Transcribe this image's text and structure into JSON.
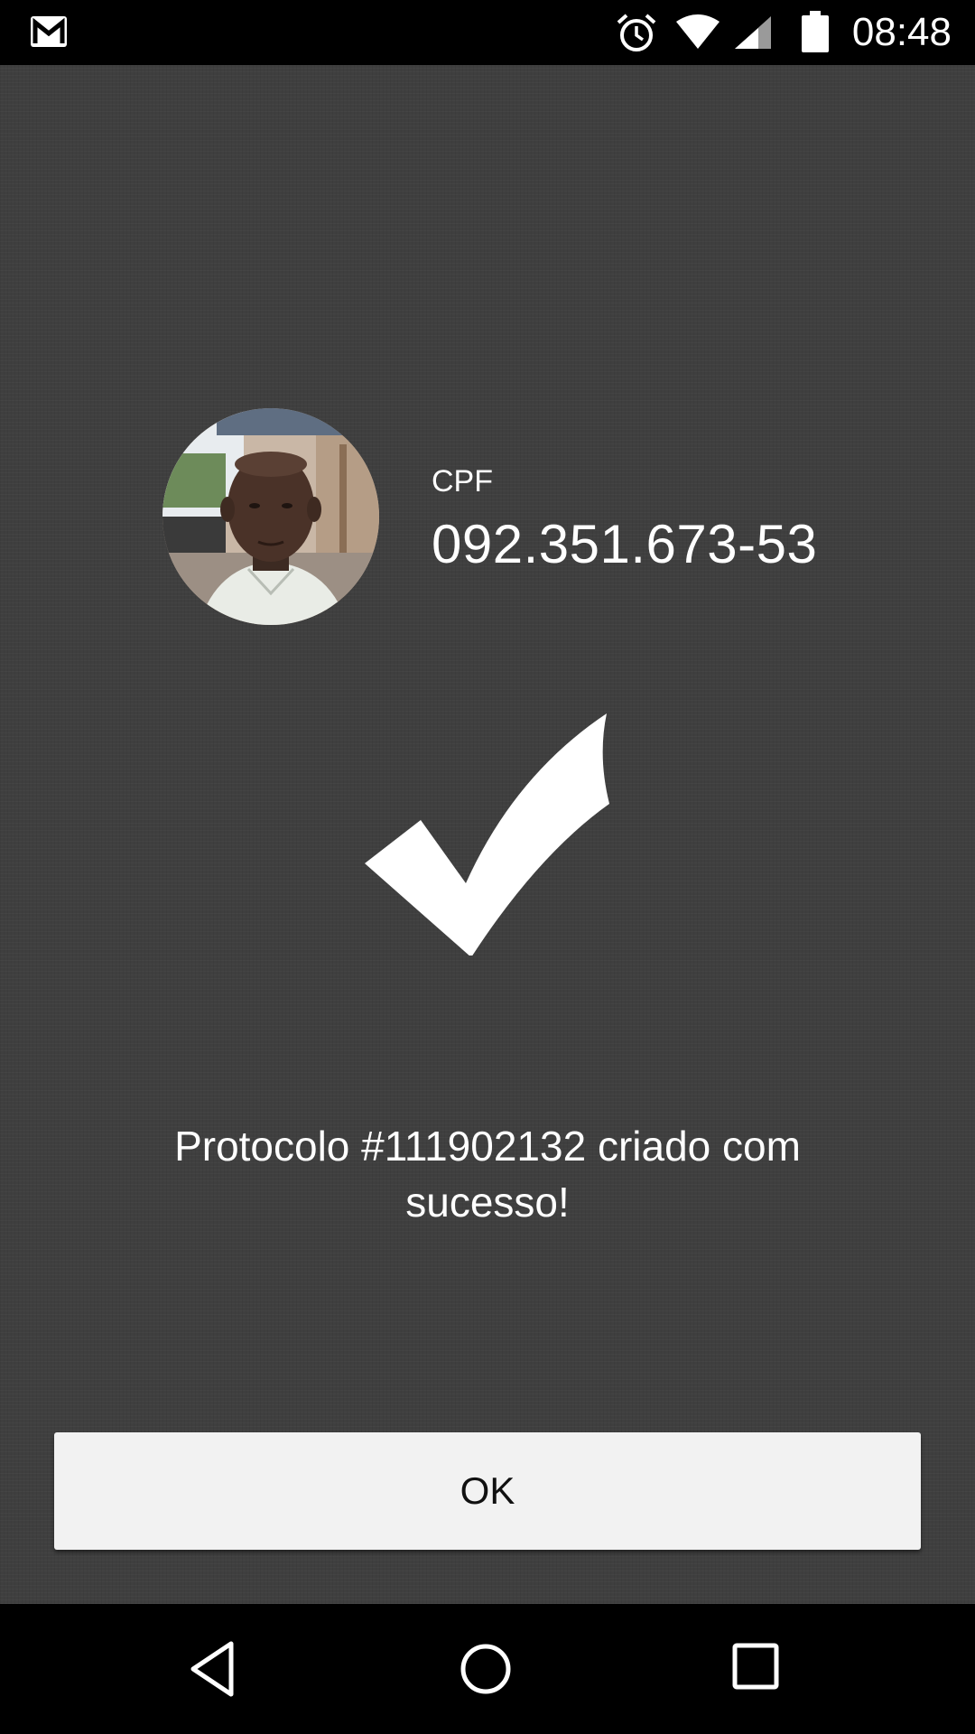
{
  "status_bar": {
    "time": "08:48",
    "icons": [
      "gmail-icon",
      "alarm-icon",
      "wifi-icon",
      "cell-signal-icon",
      "battery-icon"
    ]
  },
  "profile": {
    "cpf_label": "CPF",
    "cpf_value": "092.351.673-53",
    "avatar": "user-photo"
  },
  "result": {
    "icon": "checkmark-icon",
    "message": "Protocolo #111902132 criado com sucesso!"
  },
  "actions": {
    "ok_label": "OK"
  },
  "navigation": {
    "icons": [
      "back-icon",
      "home-icon",
      "recents-icon"
    ]
  },
  "colors": {
    "background": "#3f3f3f",
    "bars": "#000000",
    "button": "#f2f2f2",
    "text": "#ffffff"
  }
}
